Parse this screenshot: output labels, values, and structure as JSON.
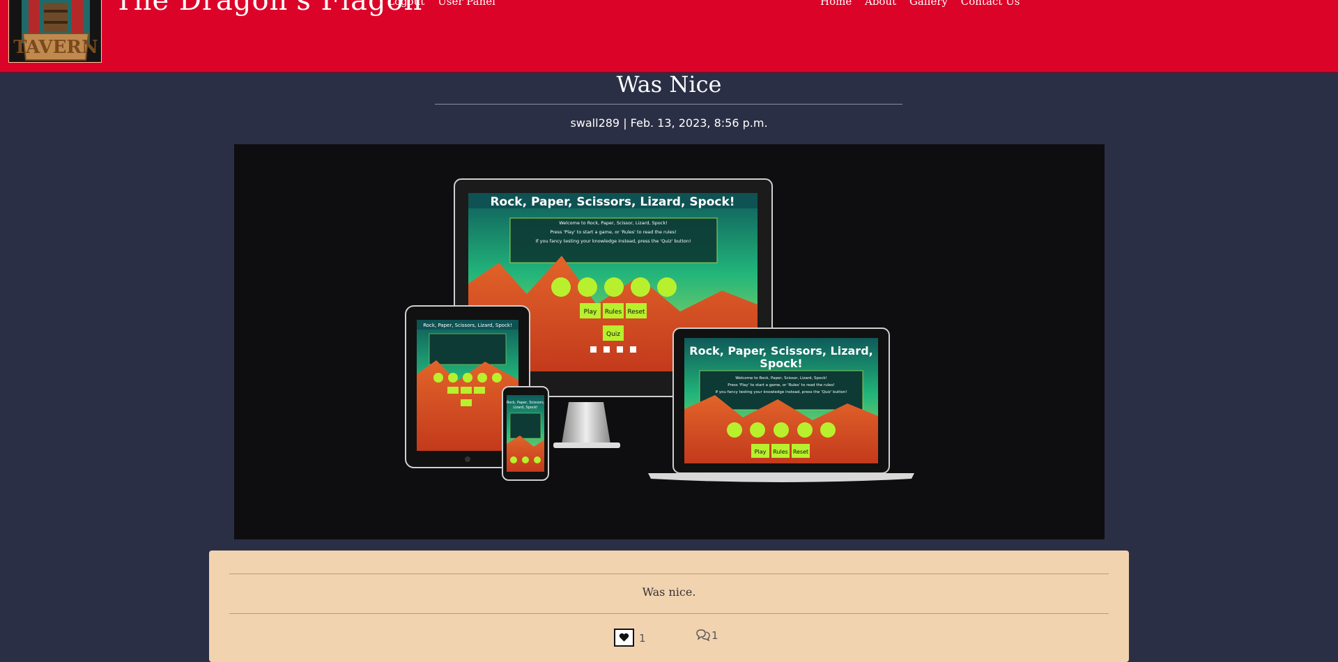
{
  "header": {
    "site_title": "The Dragon's Flagon",
    "logo_text": "TAVERN",
    "user_links": [
      "Logout",
      "User Panel"
    ],
    "nav_links": [
      "Home",
      "About",
      "Gallery",
      "Contact Us"
    ],
    "brand_color": "#dc0329"
  },
  "post": {
    "title": "Was Nice",
    "meta": "swall289 | Feb. 13, 2023, 8:56 p.m.",
    "body": "Was nice.",
    "likes": "1",
    "comments": "1"
  },
  "mockup": {
    "monitor_title": "Rock, Paper, Scissors, Lizard, Spock!",
    "laptop_title_line1": "Rock, Paper, Scissors, Lizard,",
    "laptop_title_line2": "Spock!",
    "tablet_title": "Rock, Paper, Scissors, Lizard, Spock!",
    "phone_title_line1": "Rock, Paper, Scissors,",
    "phone_title_line2": "Lizard, Spock!",
    "intro_line1": "Welcome to Rock, Paper, Scissor, Lizard, Spock!",
    "intro_line2": "Press 'Play' to start a game, or 'Rules' to read the rules!",
    "intro_line3": "If you fancy testing your knowledge instead, press the 'Quiz' button!",
    "button_play": "Play",
    "button_rules": "Rules",
    "button_reset": "Reset",
    "button_quiz": "Quiz"
  }
}
